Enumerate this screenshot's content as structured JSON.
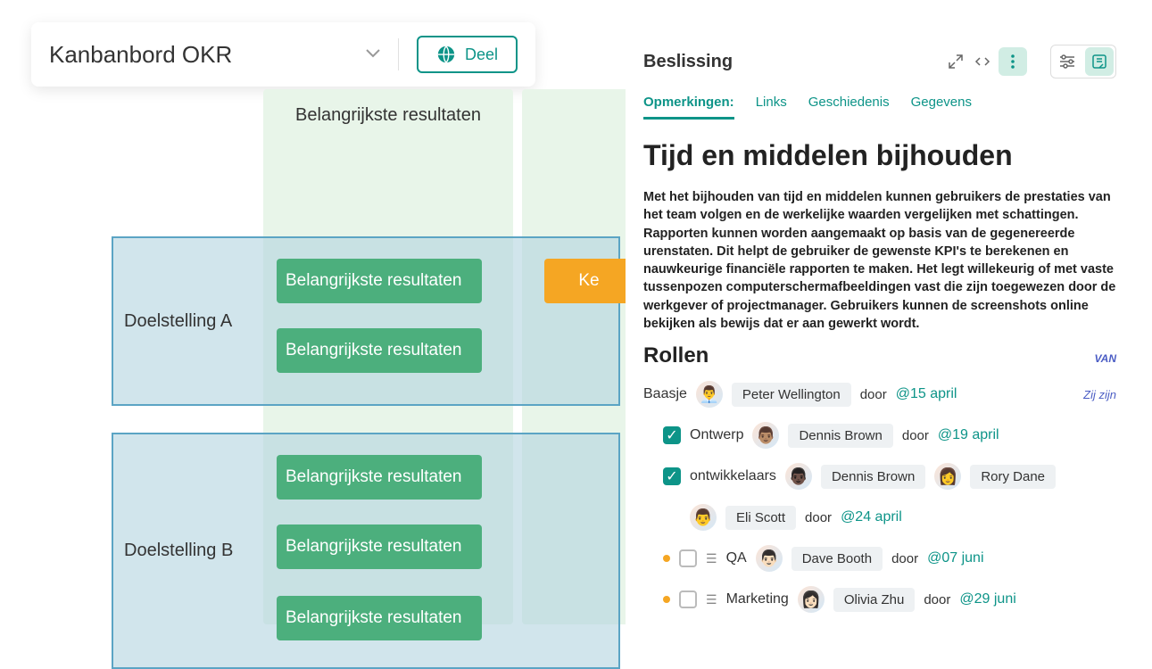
{
  "header": {
    "title": "Kanbanbord OKR",
    "share_label": "Deel"
  },
  "kanban": {
    "column_header": "Belangrijkste resultaten",
    "lanes": [
      {
        "label": "Doelstelling A"
      },
      {
        "label": "Doelstelling B"
      }
    ],
    "kr_label": "Belangrijkste resultaten",
    "orange_label": "Ke"
  },
  "panel": {
    "title": "Beslissing",
    "tabs": [
      {
        "label": "Opmerkingen:",
        "active": true
      },
      {
        "label": "Links"
      },
      {
        "label": "Geschiedenis"
      },
      {
        "label": "Gegevens"
      }
    ],
    "content_title": "Tijd en middelen bijhouden",
    "content_desc": "Met het bijhouden van tijd en middelen kunnen gebruikers de prestaties van het team volgen en de werkelijke waarden vergelijken met schattingen. Rapporten kunnen worden aangemaakt op basis van de gegenereerde urenstaten. Dit helpt de gebruiker de gewenste KPI's te berekenen en nauwkeurige financiële rapporten te maken. Het legt willekeurig of met vaste tussenpozen computerschermafbeeldingen vast die zijn toegewezen door de werkgever of projectmanager. Gebruikers kunnen de screenshots online bekijken als bewijs dat er aan gewerkt wordt.",
    "roles_title": "Rollen",
    "van_label": "VAN",
    "zij_label": "Zij zijn",
    "door_label": "door",
    "rows": {
      "owner": {
        "label": "Baasje",
        "name": "Peter Wellington",
        "date": "@15 april"
      },
      "design": {
        "label": "Ontwerp",
        "name": "Dennis Brown",
        "date": "@19 april"
      },
      "dev": {
        "label": "ontwikkelaars",
        "name1": "Dennis Brown",
        "name2": "Rory Dane",
        "name3": "Eli Scott",
        "date": "@24 april"
      },
      "qa": {
        "label": "QA",
        "name": "Dave Booth",
        "date": "@07 juni"
      },
      "marketing": {
        "label": "Marketing",
        "name": "Olivia Zhu",
        "date": "@29 juni"
      }
    }
  }
}
